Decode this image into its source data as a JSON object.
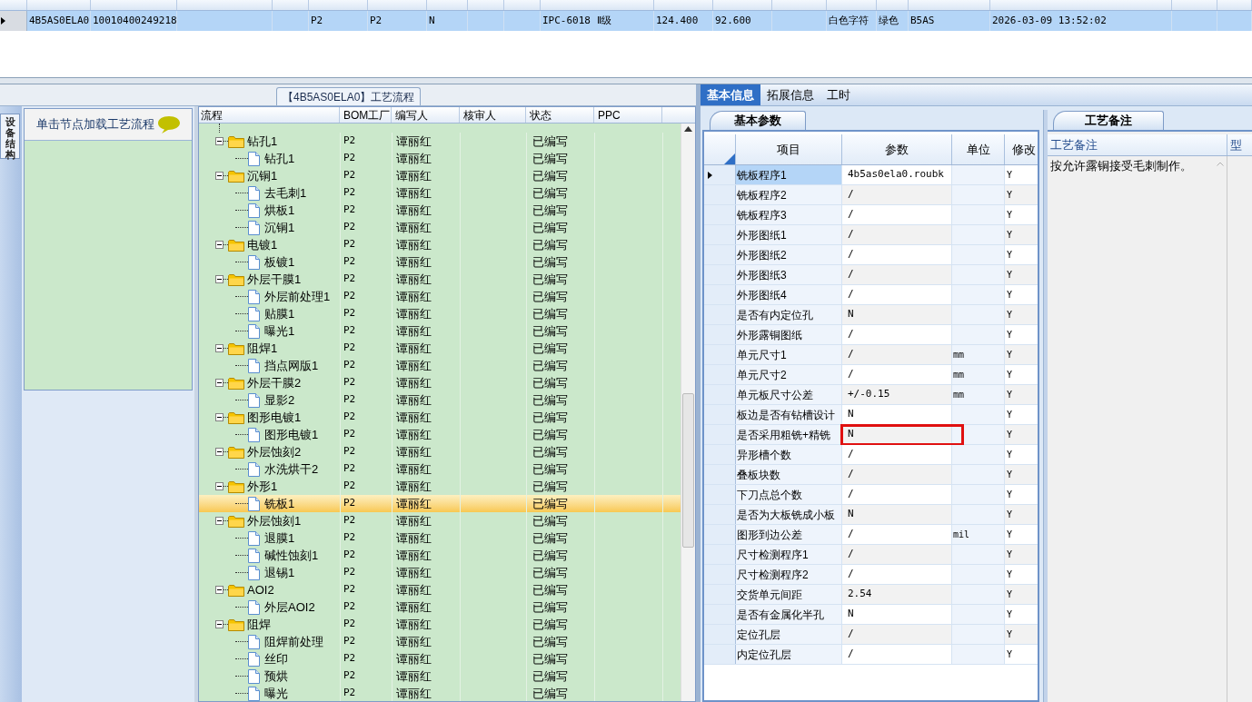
{
  "order_table": {
    "rows": [
      {
        "selected": true,
        "cells": {
          "column_1": "4B5AS0ELA0",
          "column_2": "10010400249218",
          "column_5": "P2",
          "column_6": "P2",
          "column_7": "N",
          "column_10": "IPC-6018 Ⅱ级",
          "column_11": "124.400",
          "column_12": "92.600",
          "column_14": "白色字符",
          "column_15": "绿色",
          "column_16": "B5AS",
          "column_17": "2026-03-09 13:52:02"
        }
      }
    ]
  },
  "side_tab": "设备结构",
  "hint": "单击节点加载工艺流程",
  "flow_title": "【4B5AS0ELA0】工艺流程",
  "flow_tree": {
    "columns": [
      "流程",
      "BOM工厂",
      "编写人",
      "核审人",
      "状态",
      "PPC"
    ],
    "nodes": [
      {
        "kind": "folder",
        "label": "钻孔1",
        "expanded": true,
        "selected": false,
        "bom": "P2",
        "author": "谭丽红",
        "status": "已编写",
        "children": [
          {
            "kind": "file",
            "label": "钻孔1",
            "selected": false,
            "bom": "P2",
            "author": "谭丽红",
            "status": "已编写"
          }
        ]
      },
      {
        "kind": "folder",
        "label": "沉铜1",
        "expanded": true,
        "selected": false,
        "bom": "P2",
        "author": "谭丽红",
        "status": "已编写",
        "children": [
          {
            "kind": "file",
            "label": "去毛刺1",
            "selected": false,
            "bom": "P2",
            "author": "谭丽红",
            "status": "已编写"
          },
          {
            "kind": "file",
            "label": "烘板1",
            "selected": false,
            "bom": "P2",
            "author": "谭丽红",
            "status": "已编写"
          },
          {
            "kind": "file",
            "label": "沉铜1",
            "selected": false,
            "bom": "P2",
            "author": "谭丽红",
            "status": "已编写"
          }
        ]
      },
      {
        "kind": "folder",
        "label": "电镀1",
        "expanded": true,
        "selected": false,
        "bom": "P2",
        "author": "谭丽红",
        "status": "已编写",
        "children": [
          {
            "kind": "file",
            "label": "板镀1",
            "selected": false,
            "bom": "P2",
            "author": "谭丽红",
            "status": "已编写"
          }
        ]
      },
      {
        "kind": "folder",
        "label": "外层干膜1",
        "expanded": true,
        "selected": false,
        "bom": "P2",
        "author": "谭丽红",
        "status": "已编写",
        "children": [
          {
            "kind": "file",
            "label": "外层前处理1",
            "selected": false,
            "bom": "P2",
            "author": "谭丽红",
            "status": "已编写"
          },
          {
            "kind": "file",
            "label": "贴膜1",
            "selected": false,
            "bom": "P2",
            "author": "谭丽红",
            "status": "已编写"
          },
          {
            "kind": "file",
            "label": "曝光1",
            "selected": false,
            "bom": "P2",
            "author": "谭丽红",
            "status": "已编写"
          }
        ]
      },
      {
        "kind": "folder",
        "label": "阻焊1",
        "expanded": true,
        "selected": false,
        "bom": "P2",
        "author": "谭丽红",
        "status": "已编写",
        "children": [
          {
            "kind": "file",
            "label": "挡点网版1",
            "selected": false,
            "bom": "P2",
            "author": "谭丽红",
            "status": "已编写"
          }
        ]
      },
      {
        "kind": "folder",
        "label": "外层干膜2",
        "expanded": true,
        "selected": false,
        "bom": "P2",
        "author": "谭丽红",
        "status": "已编写",
        "children": [
          {
            "kind": "file",
            "label": "显影2",
            "selected": false,
            "bom": "P2",
            "author": "谭丽红",
            "status": "已编写"
          }
        ]
      },
      {
        "kind": "folder",
        "label": "图形电镀1",
        "expanded": true,
        "selected": false,
        "bom": "P2",
        "author": "谭丽红",
        "status": "已编写",
        "children": [
          {
            "kind": "file",
            "label": "图形电镀1",
            "selected": false,
            "bom": "P2",
            "author": "谭丽红",
            "status": "已编写"
          }
        ]
      },
      {
        "kind": "folder",
        "label": "外层蚀刻2",
        "expanded": true,
        "selected": false,
        "bom": "P2",
        "author": "谭丽红",
        "status": "已编写",
        "children": [
          {
            "kind": "file",
            "label": "水洗烘干2",
            "selected": false,
            "bom": "P2",
            "author": "谭丽红",
            "status": "已编写"
          }
        ]
      },
      {
        "kind": "folder",
        "label": "外形1",
        "expanded": true,
        "selected": false,
        "bom": "P2",
        "author": "谭丽红",
        "status": "已编写",
        "children": [
          {
            "kind": "file",
            "label": "铣板1",
            "selected": true,
            "bom": "P2",
            "author": "谭丽红",
            "status": "已编写"
          }
        ]
      },
      {
        "kind": "folder",
        "label": "外层蚀刻1",
        "expanded": true,
        "selected": false,
        "bom": "P2",
        "author": "谭丽红",
        "status": "已编写",
        "children": [
          {
            "kind": "file",
            "label": "退膜1",
            "selected": false,
            "bom": "P2",
            "author": "谭丽红",
            "status": "已编写"
          },
          {
            "kind": "file",
            "label": "碱性蚀刻1",
            "selected": false,
            "bom": "P2",
            "author": "谭丽红",
            "status": "已编写"
          },
          {
            "kind": "file",
            "label": "退锡1",
            "selected": false,
            "bom": "P2",
            "author": "谭丽红",
            "status": "已编写"
          }
        ]
      },
      {
        "kind": "folder",
        "label": "AOI2",
        "expanded": true,
        "selected": false,
        "bom": "P2",
        "author": "谭丽红",
        "status": "已编写",
        "children": [
          {
            "kind": "file",
            "label": "外层AOI2",
            "selected": false,
            "bom": "P2",
            "author": "谭丽红",
            "status": "已编写"
          }
        ]
      },
      {
        "kind": "folder",
        "label": "阻焊",
        "expanded": true,
        "selected": false,
        "bom": "P2",
        "author": "谭丽红",
        "status": "已编写",
        "children": [
          {
            "kind": "file",
            "label": "阻焊前处理",
            "selected": false,
            "bom": "P2",
            "author": "谭丽红",
            "status": "已编写"
          },
          {
            "kind": "file",
            "label": "丝印",
            "selected": false,
            "bom": "P2",
            "author": "谭丽红",
            "status": "已编写"
          },
          {
            "kind": "file",
            "label": "预烘",
            "selected": false,
            "bom": "P2",
            "author": "谭丽红",
            "status": "已编写"
          },
          {
            "kind": "file",
            "label": "曝光",
            "selected": false,
            "bom": "P2",
            "author": "谭丽红",
            "status": "已编写"
          }
        ]
      }
    ]
  },
  "detail_tabs": [
    {
      "label": "基本信息",
      "selected": true
    },
    {
      "label": "拓展信息",
      "selected": false
    },
    {
      "label": "工时",
      "selected": false
    }
  ],
  "basic_params": {
    "tab": "基本参数",
    "columns": [
      "项目",
      "参数",
      "单位",
      "修改"
    ],
    "rows": [
      {
        "item": "铣板程序1",
        "value": "4b5as0ela0.roubk",
        "modified": "Y",
        "selected": true
      },
      {
        "item": "铣板程序2",
        "value": "/",
        "modified": "Y",
        "selected": false
      },
      {
        "item": "铣板程序3",
        "value": "/",
        "modified": "Y",
        "selected": false
      },
      {
        "item": "外形图纸1",
        "value": "/",
        "modified": "Y",
        "selected": false
      },
      {
        "item": "外形图纸2",
        "value": "/",
        "modified": "Y",
        "selected": false
      },
      {
        "item": "外形图纸3",
        "value": "/",
        "modified": "Y",
        "selected": false
      },
      {
        "item": "外形图纸4",
        "value": "/",
        "modified": "Y",
        "selected": false
      },
      {
        "item": "是否有内定位孔",
        "value": "N",
        "modified": "Y",
        "selected": false
      },
      {
        "item": "外形露铜图纸",
        "value": "/",
        "modified": "Y",
        "selected": false
      },
      {
        "item": "单元尺寸1",
        "value": "/",
        "unit": "mm",
        "modified": "Y",
        "selected": false
      },
      {
        "item": "单元尺寸2",
        "value": "/",
        "unit": "mm",
        "modified": "Y",
        "selected": false
      },
      {
        "item": "单元板尺寸公差",
        "value": "+/-0.15",
        "unit": "mm",
        "modified": "Y",
        "selected": false
      },
      {
        "item": "板边是否有钻槽设计",
        "value": "N",
        "modified": "Y",
        "selected": false
      },
      {
        "item": "是否采用粗铣+精铣",
        "value": "N",
        "modified": "Y",
        "selected": false,
        "highlighted": true
      },
      {
        "item": "异形槽个数",
        "value": "/",
        "modified": "Y",
        "selected": false
      },
      {
        "item": "叠板块数",
        "value": "/",
        "modified": "Y",
        "selected": false
      },
      {
        "item": "下刀点总个数",
        "value": "/",
        "modified": "Y",
        "selected": false
      },
      {
        "item": "是否为大板铣成小板",
        "value": "N",
        "modified": "Y",
        "selected": false
      },
      {
        "item": "图形到边公差",
        "value": "/",
        "unit": "mil",
        "modified": "Y",
        "selected": false
      },
      {
        "item": "尺寸检测程序1",
        "value": "/",
        "modified": "Y",
        "selected": false
      },
      {
        "item": "尺寸检测程序2",
        "value": "/",
        "modified": "Y",
        "selected": false
      },
      {
        "item": "交货单元间距",
        "value": "2.54",
        "modified": "Y",
        "selected": false
      },
      {
        "item": "是否有金属化半孔",
        "value": "N",
        "modified": "Y",
        "selected": false
      },
      {
        "item": "定位孔层",
        "value": "/",
        "modified": "Y",
        "selected": false
      },
      {
        "item": "内定位孔层",
        "value": "/",
        "modified": "Y",
        "selected": false
      }
    ]
  },
  "process_notes": {
    "tab": "工艺备注",
    "columns": [
      "工艺备注",
      "型"
    ],
    "text": "按允许露铜接受毛刺制作。"
  }
}
